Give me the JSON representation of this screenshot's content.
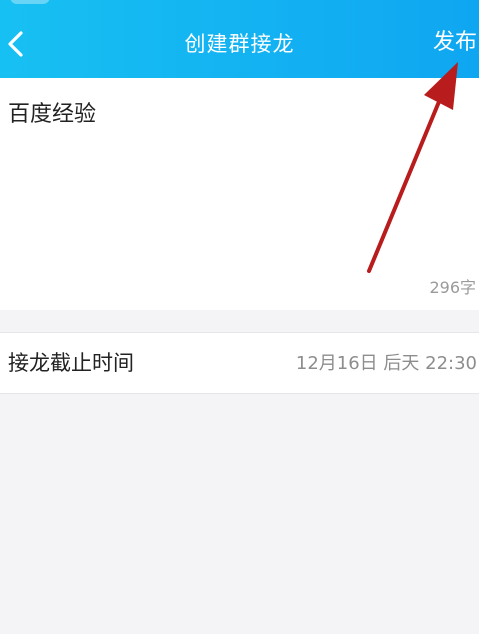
{
  "header": {
    "title": "创建群接龙",
    "publish_label": "发布",
    "background_color": "#13b2f2"
  },
  "editor": {
    "text": "百度经验",
    "char_count": "296字"
  },
  "deadline": {
    "label": "接龙截止时间",
    "value": "12月16日 后天 22:30"
  },
  "annotation": {
    "color": "#b81c1c"
  }
}
